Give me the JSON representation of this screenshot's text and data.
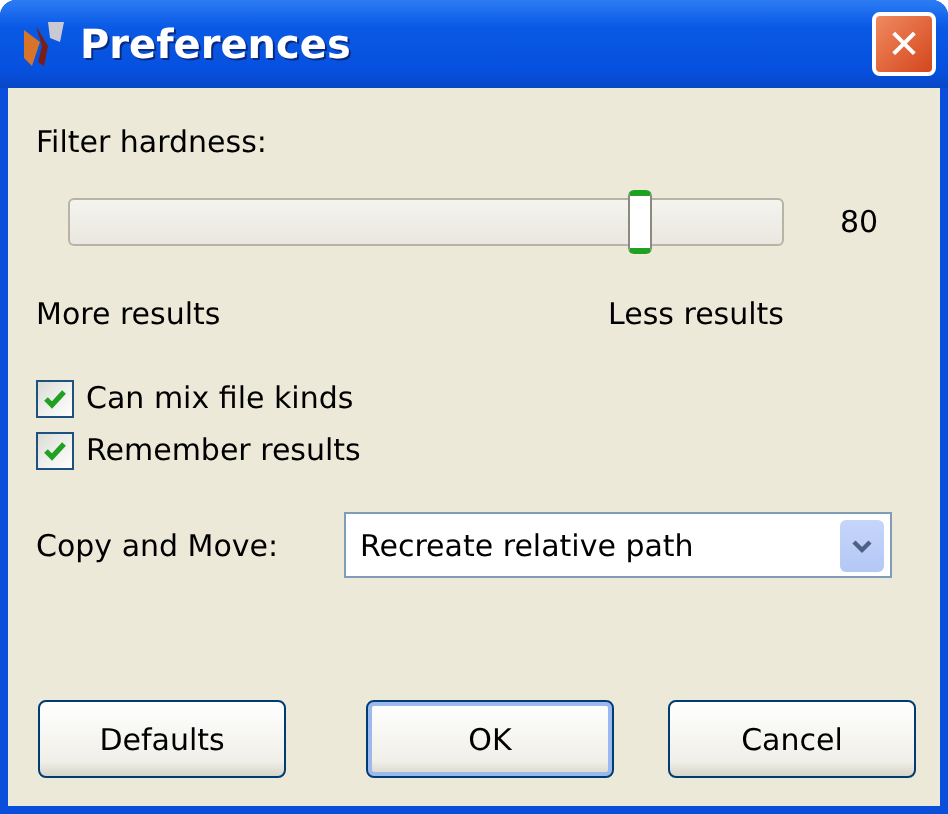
{
  "window": {
    "title": "Preferences",
    "close": "✕"
  },
  "filter": {
    "label": "Filter hardness:",
    "level": 0.8,
    "reading": "80",
    "min_label": "More results",
    "max_label": "Less results"
  },
  "options": [
    {
      "label": "Can mix file kinds",
      "checked": true
    },
    {
      "label": "Remember results",
      "checked": true
    }
  ],
  "copy_move": {
    "label": "Copy and Move:",
    "value": "Recreate relative path"
  },
  "buttons": [
    {
      "label": "Defaults",
      "default": false
    },
    {
      "label": "OK",
      "default": true
    },
    {
      "label": "Cancel",
      "default": false
    }
  ]
}
